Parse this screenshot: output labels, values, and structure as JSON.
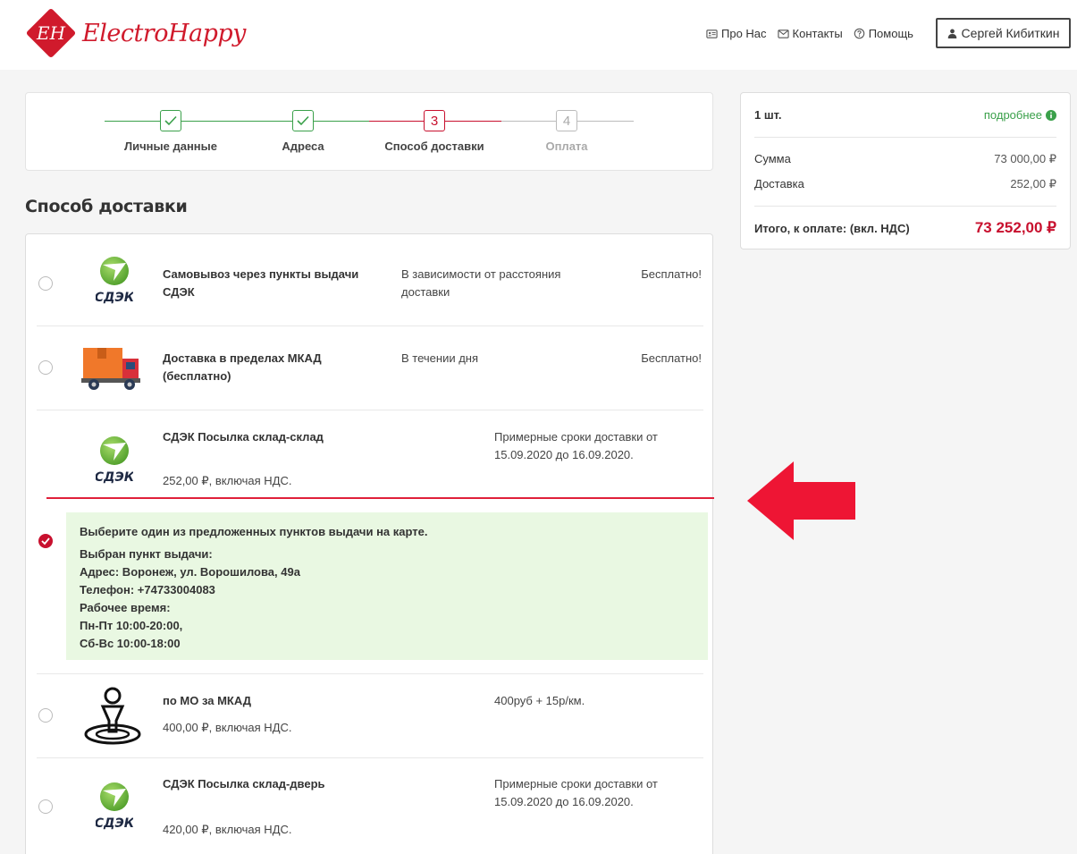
{
  "header": {
    "logo_text": "ElectroHappy",
    "logo_monogram": "EH",
    "nav": [
      {
        "label": "Про Нас",
        "icon": "id-card-icon"
      },
      {
        "label": "Контакты",
        "icon": "envelope-icon"
      },
      {
        "label": "Помощь",
        "icon": "question-circle-icon"
      }
    ],
    "user_name": "Сергей Кибиткин"
  },
  "steps": [
    {
      "number": "1",
      "label": "Личные данные",
      "state": "done"
    },
    {
      "number": "2",
      "label": "Адреса",
      "state": "done"
    },
    {
      "number": "3",
      "label": "Способ доставки",
      "state": "active"
    },
    {
      "number": "4",
      "label": "Оплата",
      "state": "pending"
    }
  ],
  "section_title": "Способ доставки",
  "options": [
    {
      "name": "Самовывоз через пункты выдачи СДЭК",
      "description": "В зависимости от расстояния доставки",
      "price": "Бесплатно!",
      "logo": "cdek-logo",
      "selected": false
    },
    {
      "name": "Доставка в пределах МКАД (бесплатно)",
      "description": "В течении дня",
      "price": "Бесплатно!",
      "logo": "truck-icon",
      "selected": false
    },
    {
      "name": "СДЭК Посылка склад-склад",
      "description": "Примерные сроки доставки от 15.09.2020 до 16.09.2020.",
      "price_note": "252,00 ₽, включая НДС.",
      "logo": "cdek-logo",
      "selected": true
    },
    {
      "name": "по МО за МКАД",
      "description": "400руб + 15р/км.",
      "price_note": "400,00 ₽, включая НДС.",
      "logo": "map-pin-person-icon",
      "selected": false
    },
    {
      "name": "СДЭК Посылка склад-дверь",
      "description": "Примерные сроки доставки от 15.09.2020 до 16.09.2020.",
      "price_note": "420,00 ₽, включая НДС.",
      "logo": "cdek-logo",
      "selected": false
    }
  ],
  "cdek_label": "СДЭК",
  "pickup_info": {
    "prompt": "Выберите один из предложенных пунктов выдачи на карте.",
    "lines": [
      "Выбран пункт выдачи:",
      "Адрес: Воронеж, ул. Ворошилова, 49а",
      "Телефон: +74733004083",
      "Рабочее время:",
      "Пн-Пт 10:00-20:00,",
      "Сб-Вс 10:00-18:00"
    ]
  },
  "summary": {
    "qty": "1 шт.",
    "details_link": "подробнее",
    "sum_label": "Сумма",
    "sum_value": "73 000,00 ₽",
    "delivery_label": "Доставка",
    "delivery_value": "252,00 ₽",
    "total_label": "Итого, к оплате: (вкл. НДС)",
    "total_value": "73 252,00 ₽"
  },
  "colors": {
    "brand_red": "#d01a2c",
    "done_green": "#3aa04a",
    "active_red": "#c8102e",
    "pending_gray": "#bbbbbb",
    "info_bg": "#e9f8e2",
    "link_green": "#3aa04a",
    "cdek_green": "#6bb33a"
  }
}
